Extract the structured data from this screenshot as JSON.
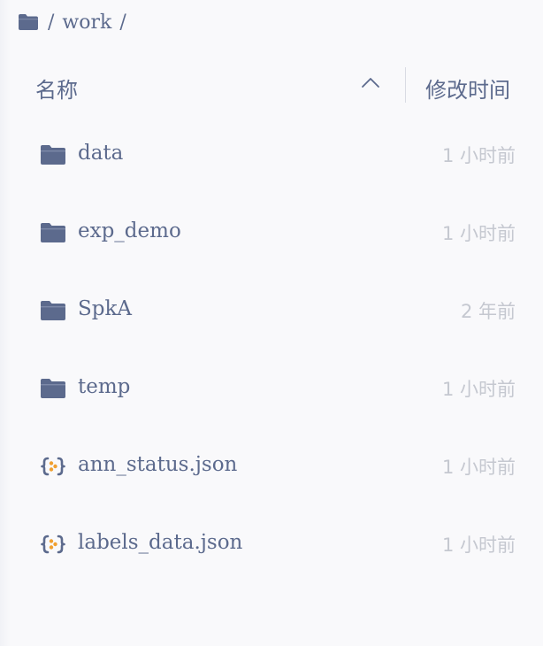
{
  "breadcrumb": {
    "root_icon": "folder-icon",
    "separator": "/",
    "path": [
      "work"
    ]
  },
  "header": {
    "name_label": "名称",
    "sort_icon": "chevron-up-icon",
    "mtime_label": "修改时间"
  },
  "files": [
    {
      "name": "data",
      "type": "folder",
      "icon": "folder-icon",
      "modified": "1 小时前"
    },
    {
      "name": "exp_demo",
      "type": "folder",
      "icon": "folder-icon",
      "modified": "1 小时前"
    },
    {
      "name": "SpkA",
      "type": "folder",
      "icon": "folder-icon",
      "modified": "2 年前"
    },
    {
      "name": "temp",
      "type": "folder",
      "icon": "folder-icon",
      "modified": "1 小时前"
    },
    {
      "name": "ann_status.json",
      "type": "json",
      "icon": "json-file-icon",
      "modified": "1 小时前"
    },
    {
      "name": "labels_data.json",
      "type": "json",
      "icon": "json-file-icon",
      "modified": "1 小时前"
    }
  ],
  "colors": {
    "text": "#5c6a8d",
    "muted": "#c5c8d0",
    "json_accent": "#f0a030",
    "background": "#f9f9fb"
  }
}
